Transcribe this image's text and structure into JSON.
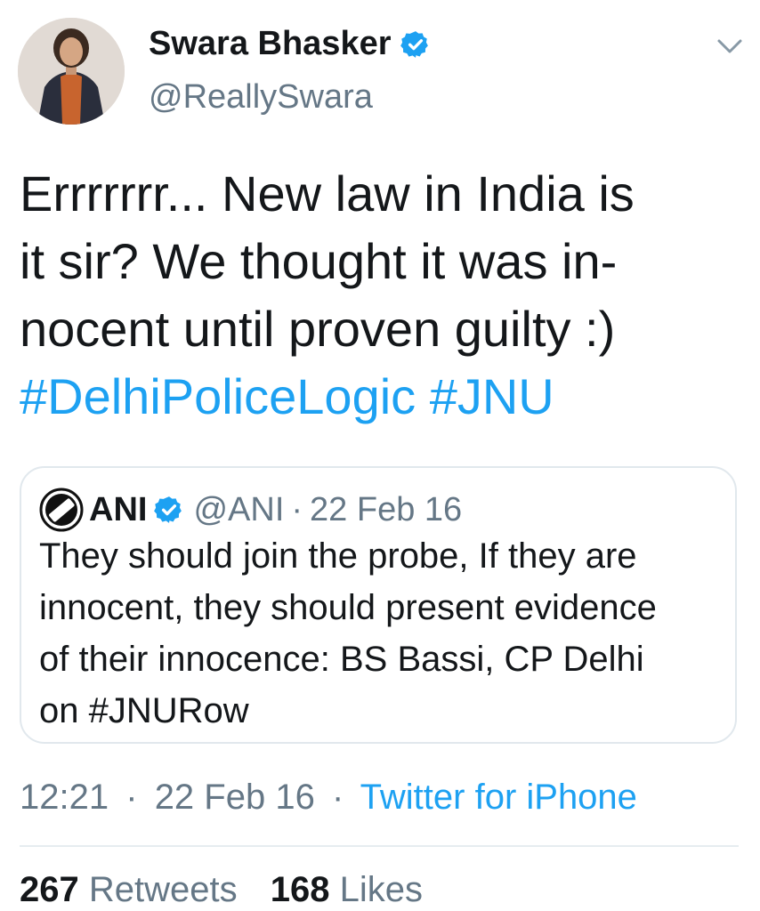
{
  "tweet": {
    "author": {
      "display_name": "Swara Bhasker",
      "handle": "@ReallySwara",
      "verified": true
    },
    "text_lines": [
      "Errrrrrr... New law in India is",
      "it sir?  We thought it was in-",
      "nocent until proven guilty :)"
    ],
    "hashtags": "#DelhiPoliceLogic #JNU",
    "quoted": {
      "author_name": "ANI",
      "handle": "@ANI",
      "separator": "·",
      "date": "22 Feb 16",
      "verified": true,
      "text_lines": [
        "They should join the probe, If they are",
        "innocent, they should present evidence",
        "of their innocence: BS Bassi, CP Delhi",
        "on #JNURow"
      ]
    },
    "meta": {
      "time": "12:21",
      "separator": "·",
      "date": "22 Feb 16",
      "source": "Twitter for iPhone"
    },
    "stats": {
      "retweets_count": "267",
      "retweets_label": "Retweets",
      "likes_count": "168",
      "likes_label": "Likes"
    }
  },
  "icons": {
    "verified": "verified-badge-icon",
    "menu": "chevron-down-icon",
    "quoted_avatar": "ani-logo-icon"
  },
  "colors": {
    "link": "#1da1f2",
    "secondary_text": "#657786",
    "primary_text": "#14171a",
    "border": "#e1e8ed"
  }
}
